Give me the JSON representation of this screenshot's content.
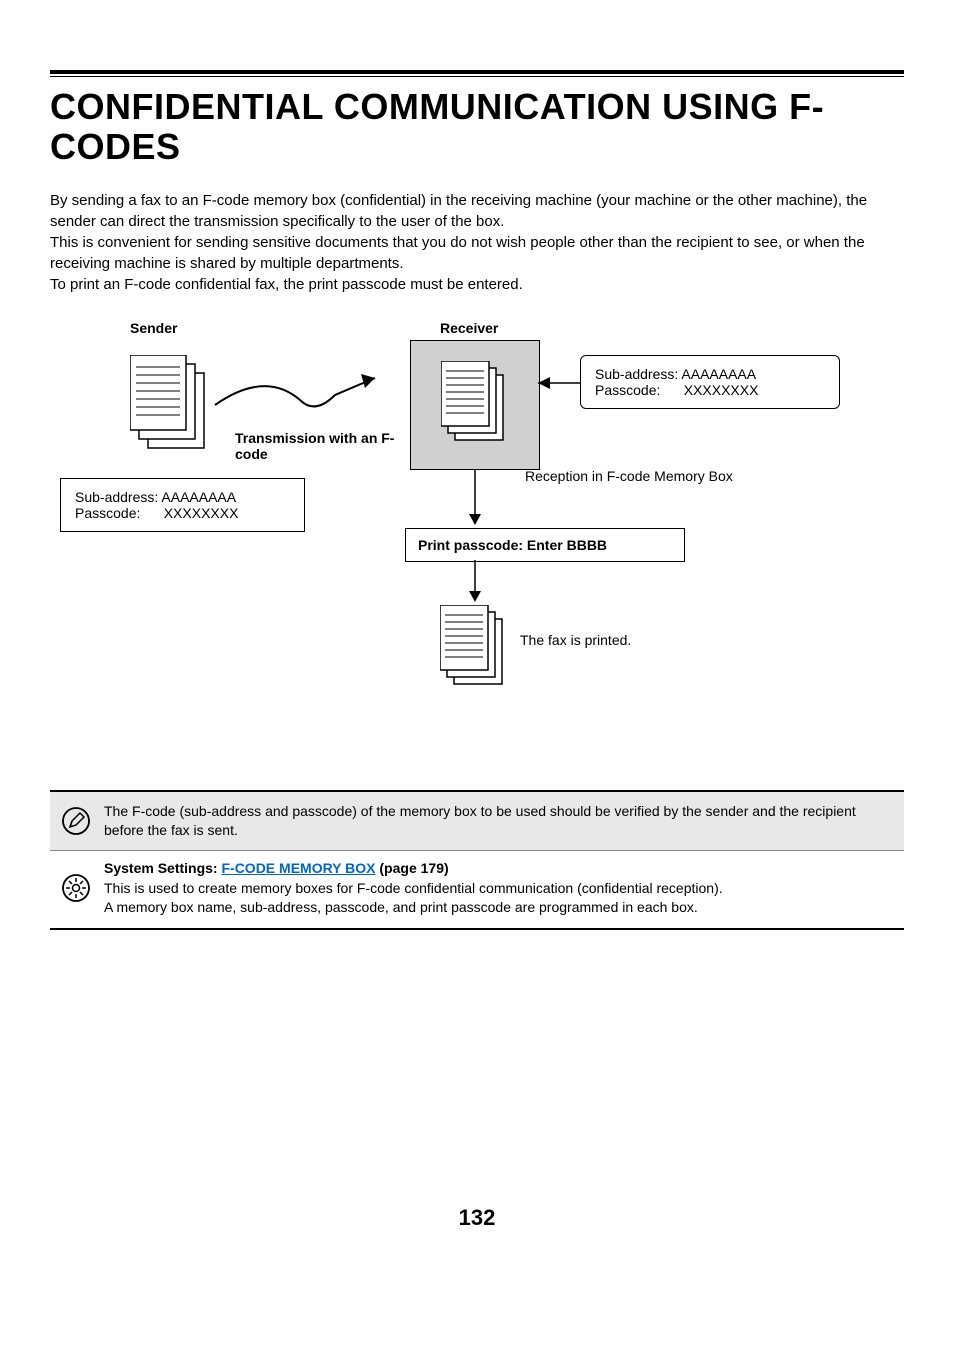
{
  "title": "CONFIDENTIAL COMMUNICATION USING F-CODES",
  "intro": {
    "p1": "By sending a fax to an F-code memory box (confidential) in the receiving machine (your machine or the other machine), the sender can direct the transmission specifically to the user of the box.",
    "p2": "This is convenient for sending sensitive documents that you do not wish people other than the recipient to see, or when the receiving machine is shared by multiple departments.",
    "p3": "To print an F-code confidential fax, the print passcode must be entered."
  },
  "diagram": {
    "sender_label": "Sender",
    "receiver_label": "Receiver",
    "transmission_label": "Transmission with an F-code",
    "reception_label": "Reception in F-code Memory Box",
    "passcode_prompt": "Print passcode: Enter BBBB",
    "printed_label": "The fax is printed.",
    "sender_box": {
      "subaddress_label": "Sub-address:",
      "subaddress_value": "AAAAAAAA",
      "passcode_label": "Passcode:",
      "passcode_value": "XXXXXXXX"
    },
    "receiver_box": {
      "subaddress_label": "Sub-address:",
      "subaddress_value": "AAAAAAAA",
      "passcode_label": "Passcode:",
      "passcode_value": "XXXXXXXX"
    }
  },
  "note": {
    "text": "The F-code (sub-address and passcode) of the memory box to be used should be verified by the sender and the recipient before the fax is sent."
  },
  "settings": {
    "prefix": "System Settings: ",
    "link": "F-CODE MEMORY BOX",
    "suffix": " (page 179)",
    "line1": "This is used to create memory boxes for F-code confidential communication (confidential reception).",
    "line2": "A memory box name, sub-address, passcode, and print passcode are programmed in each box."
  },
  "page_number": "132"
}
